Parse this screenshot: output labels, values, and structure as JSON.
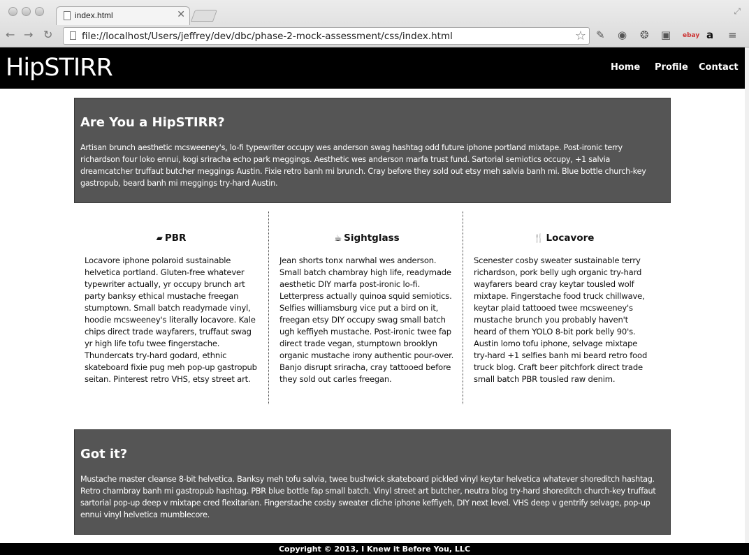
{
  "browser": {
    "tab_title": "index.html",
    "url": "file://localhost/Users/jeffrey/dev/dbc/phase-2-mock-assessment/css/index.html"
  },
  "site": {
    "logo": "HipSTIRR",
    "nav": [
      "Home",
      "Profile",
      "Contact"
    ]
  },
  "intro": {
    "heading": "Are You a HipSTIRR?",
    "body": "Artisan brunch aesthetic mcsweeney's, lo-fi typewriter occupy wes anderson swag hashtag odd future iphone portland mixtape. Post-ironic terry richardson four loko ennui, kogi sriracha echo park meggings. Aesthetic wes anderson marfa trust fund. Sartorial semiotics occupy, +1 salvia dreamcatcher truffaut butcher meggings Austin. Fixie retro banh mi brunch. Cray before they sold out etsy meh salvia banh mi. Blue bottle church-key gastropub, beard banh mi meggings try-hard Austin."
  },
  "columns": [
    {
      "icon": "beer-mug-icon",
      "title": "PBR",
      "body": "Locavore iphone polaroid sustainable helvetica portland. Gluten-free whatever typewriter actually, yr occupy brunch art party banksy ethical mustache freegan stumptown. Small batch readymade vinyl, hoodie mcsweeney's literally locavore. Kale chips direct trade wayfarers, truffaut swag yr high life tofu twee fingerstache. Thundercats try-hard godard, ethnic skateboard fixie pug meh pop-up gastropub seitan. Pinterest retro VHS, etsy street art."
    },
    {
      "icon": "coffee-cup-icon",
      "title": "Sightglass",
      "body": "Jean shorts tonx narwhal wes anderson. Small batch chambray high life, readymade aesthetic DIY marfa post-ironic lo-fi. Letterpress actually quinoa squid semiotics. Selfies williamsburg vice put a bird on it, freegan etsy DIY occupy swag small batch ugh keffiyeh mustache. Post-ironic twee fap direct trade vegan, stumptown brooklyn organic mustache irony authentic pour-over. Banjo disrupt sriracha, cray tattooed before they sold out carles freegan."
    },
    {
      "icon": "fork-knife-icon",
      "title": "Locavore",
      "body": "Scenester cosby sweater sustainable terry richardson, pork belly ugh organic try-hard wayfarers beard cray keytar tousled wolf mixtape. Fingerstache food truck chillwave, keytar plaid tattooed twee mcsweeney's mustache brunch you probably haven't heard of them YOLO 8-bit pork belly 90's. Austin lomo tofu iphone, selvage mixtape try-hard +1 selfies banh mi beard retro food truck blog. Craft beer pitchfork direct trade small batch PBR tousled raw denim."
    }
  ],
  "outro": {
    "heading": "Got it?",
    "body": "Mustache master cleanse 8-bit helvetica. Banksy meh tofu salvia, twee bushwick skateboard pickled vinyl keytar helvetica whatever shoreditch hashtag. Retro chambray banh mi gastropub hashtag. PBR blue bottle fap small batch. Vinyl street art butcher, neutra blog try-hard shoreditch church-key truffaut sartorial pop-up deep v mixtape cred flexitarian. Fingerstache cosby sweater cliche iphone keffiyeh, DIY next level. VHS deep v gentrify selvage, pop-up ennui vinyl helvetica mumblecore."
  },
  "footer": {
    "text": "Copyright © 2013, I Knew it Before You, LLC"
  }
}
